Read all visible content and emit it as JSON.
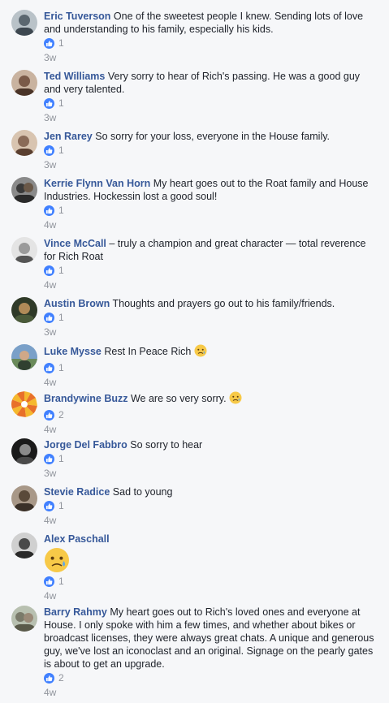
{
  "comments": [
    {
      "author": "Eric Tuverson",
      "text": "One of the sweetest people I knew. Sending lots of love and understanding to his family, especially his kids.",
      "likes": "1",
      "time": "3w",
      "avatar_color": "#5b6770"
    },
    {
      "author": "Ted Williams",
      "text": "Very sorry to hear of Rich's passing. He was a good guy and very talented.",
      "likes": "1",
      "time": "3w",
      "avatar_color": "#7a5a48"
    },
    {
      "author": "Jen Rarey",
      "text": "So sorry for your loss, everyone in the House family.",
      "likes": "1",
      "time": "3w",
      "avatar_color": "#8a6b58"
    },
    {
      "author": "Kerrie Flynn Van Horn",
      "text": "My heart goes out to the Roat family and House Industries. Hockessin lost a good soul!",
      "likes": "1",
      "time": "4w",
      "avatar_color": "#3a3a3a"
    },
    {
      "author": "Vince McCall",
      "text": "– truly a champion and great character — total reverence for Rich Roat",
      "likes": "1",
      "time": "4w",
      "avatar_color": "#9a9a9a"
    },
    {
      "author": "Austin Brown",
      "text": "Thoughts and prayers go out to his family/friends.",
      "likes": "1",
      "time": "3w",
      "avatar_color": "#4a5a3a"
    },
    {
      "author": "Luke Mysse",
      "text": "Rest In Peace Rich",
      "likes": "1",
      "time": "4w",
      "avatar_color": "#6a8a5a",
      "emoji": "sad-tear-emoji"
    },
    {
      "author": "Brandywine Buzz",
      "text": "We are so very sorry.",
      "likes": "2",
      "time": "4w",
      "avatar_color": "#f5b82e",
      "emoji": "sad-tear-emoji"
    },
    {
      "author": "Jorge Del Fabbro",
      "text": "So sorry to hear",
      "likes": "1",
      "time": "3w",
      "avatar_color": "#2a2a2a"
    },
    {
      "author": "Stevie Radice",
      "text": "Sad to young",
      "likes": "1",
      "time": "4w",
      "avatar_color": "#5a4a3a"
    },
    {
      "author": "Alex Paschall",
      "text": "",
      "likes": "1",
      "time": "4w",
      "avatar_color": "#4a4a4a",
      "big_emoji": "sad-tear-emoji"
    },
    {
      "author": "Barry Rahmy",
      "text": "My heart goes out to Rich's loved ones and everyone at House. I only spoke with him a few times, and whether about bikes or broadcast licenses, they were always great chats. A unique and generous guy, we've lost an iconoclast and an original. Signage on the pearly gates is about to get an upgrade.",
      "likes": "2",
      "time": "4w",
      "avatar_color": "#7a7a6a"
    }
  ],
  "colors": {
    "author": "#365899",
    "like_badge": "#4080ff",
    "meta": "#90949c",
    "background": "#f6f7f9"
  },
  "icons": {
    "like": "thumbs-up-icon",
    "reaction": "sad-tear-emoji"
  }
}
